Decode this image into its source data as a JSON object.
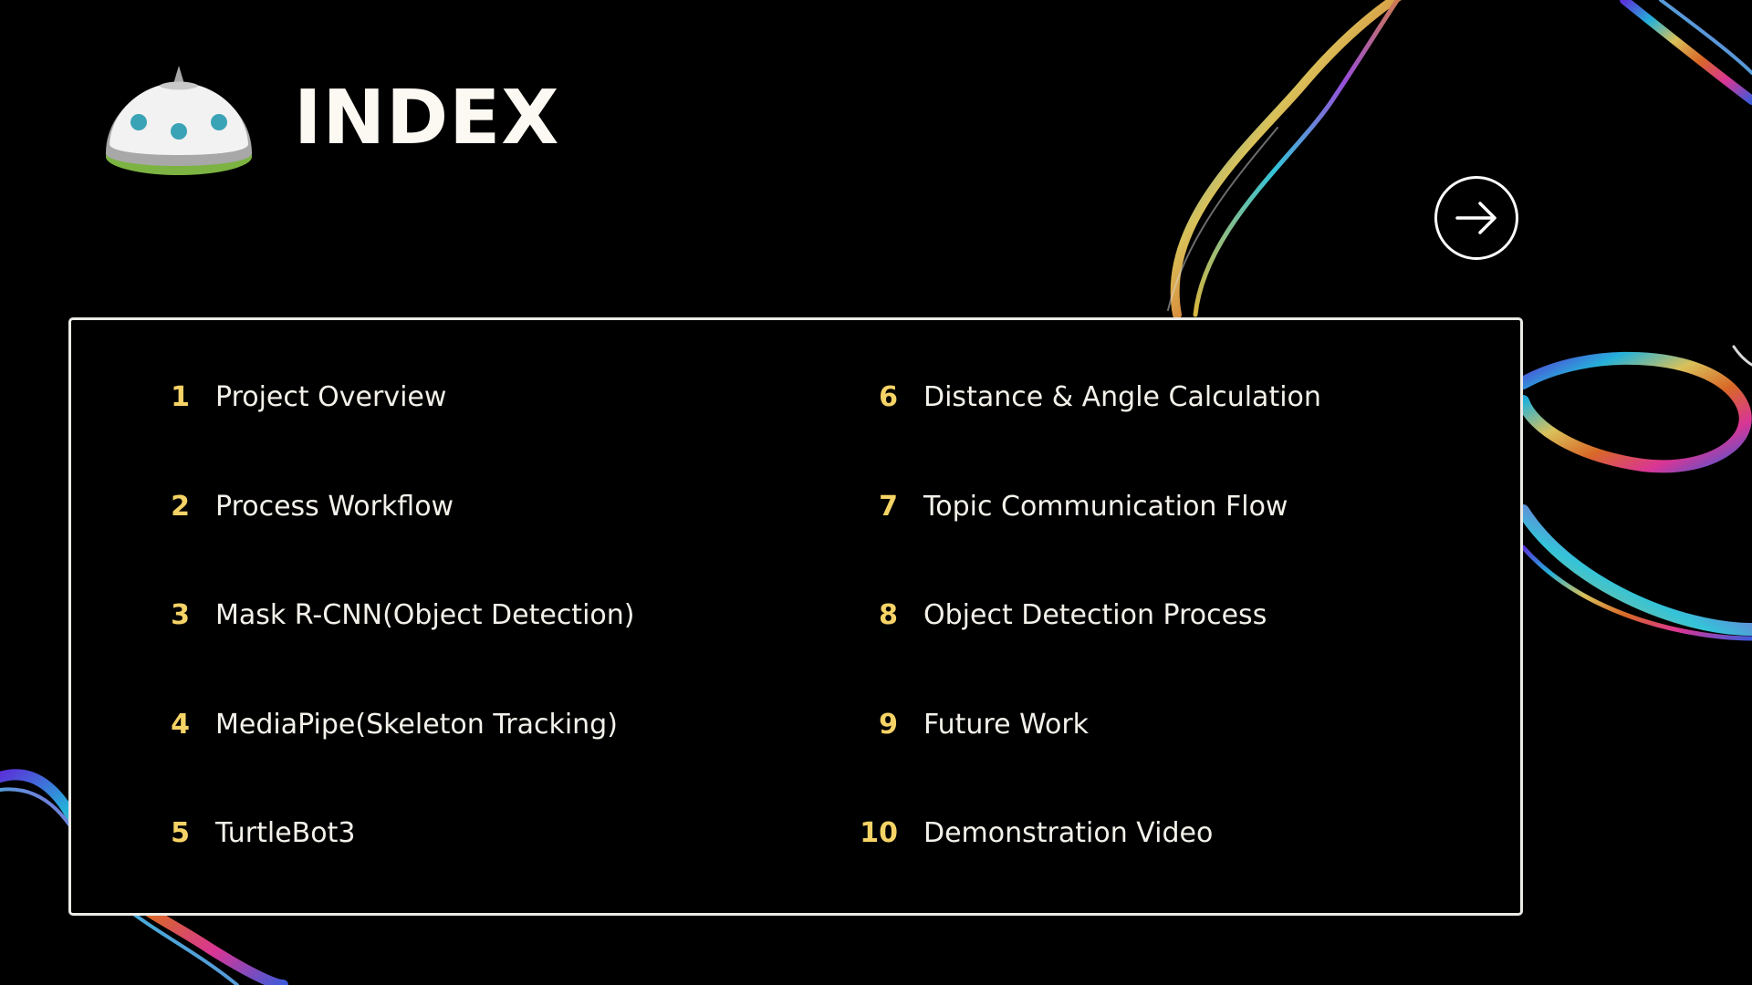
{
  "slide": {
    "title": "INDEX",
    "logo_icon": "robot-dome-icon",
    "next_icon": "arrow-right-circle-icon"
  },
  "colors": {
    "background": "#000000",
    "number_accent": "#f6d366",
    "text": "#f3f1ea",
    "panel_border": "#e9e9e6"
  },
  "index": {
    "left": [
      {
        "number": "1",
        "label": "Project Overview"
      },
      {
        "number": "2",
        "label": "Process Workflow"
      },
      {
        "number": "3",
        "label": "Mask R-CNN(Object Detection)"
      },
      {
        "number": "4",
        "label": "MediaPipe(Skeleton Tracking)"
      },
      {
        "number": "5",
        "label": "TurtleBot3"
      }
    ],
    "right": [
      {
        "number": "6",
        "label": "Distance & Angle Calculation"
      },
      {
        "number": "7",
        "label": "Topic Communication Flow"
      },
      {
        "number": "8",
        "label": "Object Detection Process"
      },
      {
        "number": "9",
        "label": "Future Work"
      },
      {
        "number": "10",
        "label": "Demonstration Video"
      }
    ]
  }
}
